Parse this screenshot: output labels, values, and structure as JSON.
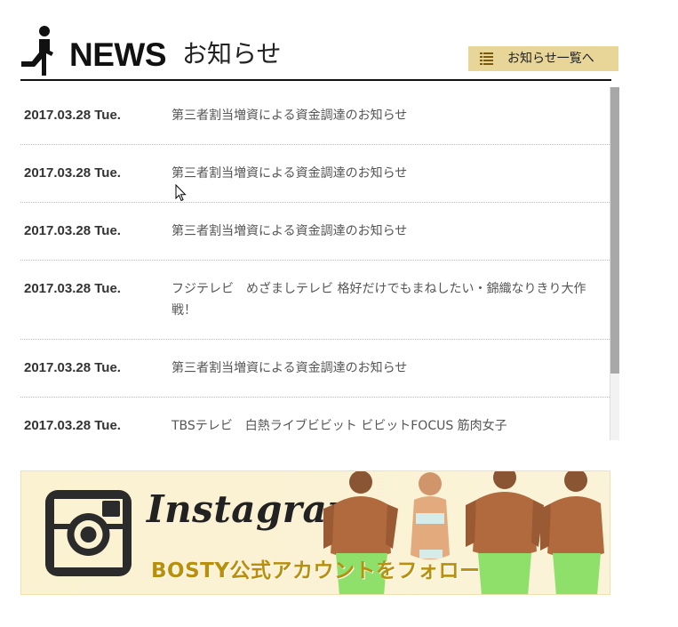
{
  "header": {
    "title": "NEWS",
    "subtitle": "お知らせ",
    "all_news_button": "お知らせ一覧へ"
  },
  "news": [
    {
      "date": "2017.03.28 Tue.",
      "text": "第三者割当増資による資金調達のお知らせ"
    },
    {
      "date": "2017.03.28 Tue.",
      "text": "第三者割当増資による資金調達のお知らせ"
    },
    {
      "date": "2017.03.28 Tue.",
      "text": "第三者割当増資による資金調達のお知らせ"
    },
    {
      "date": "2017.03.28 Tue.",
      "text": "フジテレビ　めざましテレビ 格好だけでもまねしたい・錦織なりきり大作戦！"
    },
    {
      "date": "2017.03.28 Tue.",
      "text": "第三者割当増資による資金調達のお知らせ"
    },
    {
      "date": "2017.03.28 Tue.",
      "text": "TBSテレビ　白熱ライブビビット ビビットFOCUS 筋肉女子"
    }
  ],
  "banner": {
    "wordmark": "Instagram",
    "caption": "BOSTY公式アカウントをフォロー"
  },
  "colors": {
    "button_bg": "#e8d698",
    "banner_bg": "#fbf2d2",
    "caption": "#b8900e"
  },
  "icons": [
    "runner-icon",
    "list-icon",
    "instagram-logo-icon",
    "mouse-cursor-icon"
  ]
}
